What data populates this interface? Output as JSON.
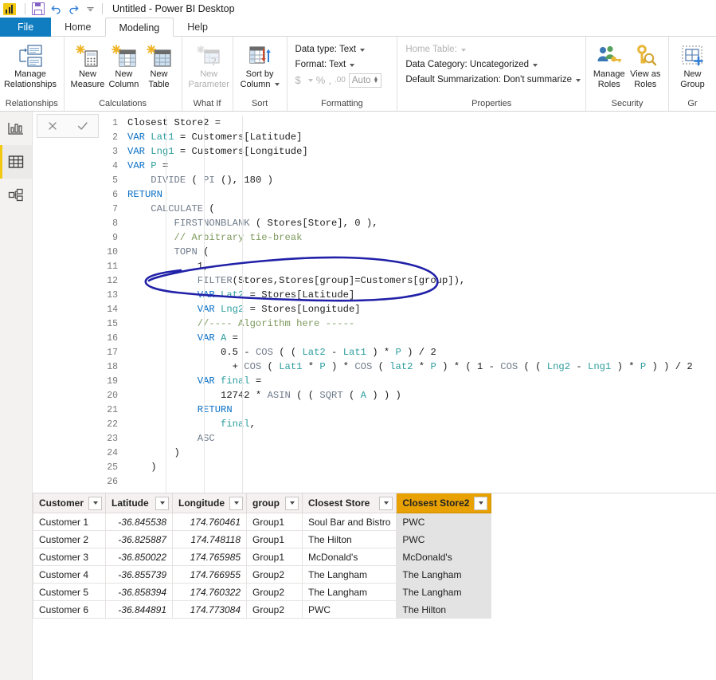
{
  "titlebar": {
    "title": "Untitled - Power BI Desktop",
    "icons": [
      "power-bi-logo",
      "save-icon",
      "undo-icon",
      "redo-icon",
      "customize-quick-access-chevron"
    ]
  },
  "tabs": [
    {
      "label": "File",
      "state": "file"
    },
    {
      "label": "Home",
      "state": "normal"
    },
    {
      "label": "Modeling",
      "state": "active"
    },
    {
      "label": "Help",
      "state": "normal"
    }
  ],
  "ribbon": {
    "groups": [
      {
        "label": "Relationships",
        "buttons": [
          {
            "label_line1": "Manage",
            "label_line2": "Relationships",
            "icon": "manage-relationships-icon",
            "disabled": false
          }
        ]
      },
      {
        "label": "Calculations",
        "buttons": [
          {
            "label_line1": "New",
            "label_line2": "Measure",
            "icon": "new-measure-icon",
            "disabled": false
          },
          {
            "label_line1": "New",
            "label_line2": "Column",
            "icon": "new-column-icon",
            "disabled": false
          },
          {
            "label_line1": "New",
            "label_line2": "Table",
            "icon": "new-table-icon",
            "disabled": false
          }
        ]
      },
      {
        "label": "What If",
        "buttons": [
          {
            "label_line1": "New",
            "label_line2": "Parameter",
            "icon": "new-parameter-icon",
            "disabled": true
          }
        ]
      },
      {
        "label": "Sort",
        "buttons": [
          {
            "label_line1": "Sort by",
            "label_line2": "Column",
            "icon": "sort-by-column-icon",
            "disabled": false
          }
        ]
      },
      {
        "label": "Formatting",
        "rows": {
          "data_type": "Data type: Text",
          "format": "Format: Text",
          "currency": "$",
          "percent": "%",
          "comma": ",",
          "decimal": ".00",
          "auto": "Auto"
        }
      },
      {
        "label": "Properties",
        "rows": {
          "home_table": "Home Table:",
          "data_category": "Data Category: Uncategorized",
          "default_summarization": "Default Summarization: Don't summarize"
        }
      },
      {
        "label": "Security",
        "buttons": [
          {
            "label_line1": "Manage",
            "label_line2": "Roles",
            "icon": "manage-roles-icon",
            "disabled": false
          },
          {
            "label_line1": "View as",
            "label_line2": "Roles",
            "icon": "view-as-roles-icon",
            "disabled": false
          }
        ]
      },
      {
        "label": "Gr",
        "buttons": [
          {
            "label_line1": "New",
            "label_line2": "Group",
            "icon": "new-group-icon",
            "disabled": false
          }
        ]
      }
    ]
  },
  "rail": {
    "items": [
      {
        "name": "report-view",
        "icon": "bar-chart-icon",
        "selected": false
      },
      {
        "name": "data-view",
        "icon": "table-grid-icon",
        "selected": true
      },
      {
        "name": "model-view",
        "icon": "relationship-model-icon",
        "selected": false
      }
    ]
  },
  "formula_bar": {
    "cancel_icon": "close-x-icon",
    "accept_icon": "checkmark-icon",
    "lines": [
      {
        "n": "1",
        "segs": [
          {
            "t": "Closest Store2 =",
            "c": "pl"
          }
        ]
      },
      {
        "n": "2",
        "segs": [
          {
            "t": "VAR ",
            "c": "k"
          },
          {
            "t": "Lat1",
            "c": "var"
          },
          {
            "t": " = Customers[Latitude]",
            "c": "pl"
          }
        ]
      },
      {
        "n": "3",
        "segs": [
          {
            "t": "VAR ",
            "c": "k"
          },
          {
            "t": "Lng1",
            "c": "var"
          },
          {
            "t": " = Customers[Longitude]",
            "c": "pl"
          }
        ]
      },
      {
        "n": "4",
        "segs": [
          {
            "t": "VAR ",
            "c": "k"
          },
          {
            "t": "P",
            "c": "var"
          },
          {
            "t": " =",
            "c": "pl"
          }
        ]
      },
      {
        "n": "5",
        "segs": [
          {
            "t": "    ",
            "c": "pl"
          },
          {
            "t": "DIVIDE",
            "c": "fn"
          },
          {
            "t": " ( ",
            "c": "pl"
          },
          {
            "t": "PI",
            "c": "fn"
          },
          {
            "t": " (), ",
            "c": "pl"
          },
          {
            "t": "180",
            "c": "num"
          },
          {
            "t": " )",
            "c": "pl"
          }
        ]
      },
      {
        "n": "6",
        "segs": [
          {
            "t": "RETURN",
            "c": "k"
          }
        ]
      },
      {
        "n": "7",
        "segs": [
          {
            "t": "    ",
            "c": "pl"
          },
          {
            "t": "CALCULATE",
            "c": "fn"
          },
          {
            "t": " (",
            "c": "pl"
          }
        ]
      },
      {
        "n": "8",
        "segs": [
          {
            "t": "        ",
            "c": "pl"
          },
          {
            "t": "FIRSTNONBLANK",
            "c": "fn"
          },
          {
            "t": " ( Stores[Store], ",
            "c": "pl"
          },
          {
            "t": "0",
            "c": "num"
          },
          {
            "t": " ),",
            "c": "pl"
          }
        ]
      },
      {
        "n": "9",
        "segs": [
          {
            "t": "        ",
            "c": "pl"
          },
          {
            "t": "// Arbitrary tie-break",
            "c": "cm"
          }
        ]
      },
      {
        "n": "10",
        "segs": [
          {
            "t": "        ",
            "c": "pl"
          },
          {
            "t": "TOPN",
            "c": "fn"
          },
          {
            "t": " (",
            "c": "pl"
          }
        ]
      },
      {
        "n": "11",
        "segs": [
          {
            "t": "            ",
            "c": "pl"
          },
          {
            "t": "1",
            "c": "num"
          },
          {
            "t": ",",
            "c": "pl"
          }
        ]
      },
      {
        "n": "12",
        "segs": [
          {
            "t": "            ",
            "c": "pl"
          },
          {
            "t": "FILTER",
            "c": "fn"
          },
          {
            "t": "(Stores,Stores[group]=Customers[group]),",
            "c": "pl"
          }
        ]
      },
      {
        "n": "13",
        "segs": [
          {
            "t": "            ",
            "c": "pl"
          },
          {
            "t": "VAR ",
            "c": "k"
          },
          {
            "t": "Lat2",
            "c": "var"
          },
          {
            "t": " = Stores[Latitude]",
            "c": "pl"
          }
        ]
      },
      {
        "n": "14",
        "segs": [
          {
            "t": "            ",
            "c": "pl"
          },
          {
            "t": "VAR ",
            "c": "k"
          },
          {
            "t": "Lng2",
            "c": "var"
          },
          {
            "t": " = Stores[Longitude]",
            "c": "pl"
          }
        ]
      },
      {
        "n": "15",
        "segs": [
          {
            "t": "            ",
            "c": "pl"
          },
          {
            "t": "//---- Algorithm here -----",
            "c": "cm"
          }
        ]
      },
      {
        "n": "16",
        "segs": [
          {
            "t": "            ",
            "c": "pl"
          },
          {
            "t": "VAR ",
            "c": "k"
          },
          {
            "t": "A",
            "c": "var"
          },
          {
            "t": " =",
            "c": "pl"
          }
        ]
      },
      {
        "n": "17",
        "segs": [
          {
            "t": "                ",
            "c": "pl"
          },
          {
            "t": "0.5",
            "c": "num"
          },
          {
            "t": " - ",
            "c": "pl"
          },
          {
            "t": "COS",
            "c": "fn"
          },
          {
            "t": " ( ( ",
            "c": "pl"
          },
          {
            "t": "Lat2",
            "c": "var"
          },
          {
            "t": " - ",
            "c": "pl"
          },
          {
            "t": "Lat1",
            "c": "var"
          },
          {
            "t": " ) * ",
            "c": "pl"
          },
          {
            "t": "P",
            "c": "var"
          },
          {
            "t": " ) / ",
            "c": "pl"
          },
          {
            "t": "2",
            "c": "num"
          }
        ]
      },
      {
        "n": "18",
        "segs": [
          {
            "t": "                  + ",
            "c": "pl"
          },
          {
            "t": "COS",
            "c": "fn"
          },
          {
            "t": " ( ",
            "c": "pl"
          },
          {
            "t": "Lat1",
            "c": "var"
          },
          {
            "t": " * ",
            "c": "pl"
          },
          {
            "t": "P",
            "c": "var"
          },
          {
            "t": " ) * ",
            "c": "pl"
          },
          {
            "t": "COS",
            "c": "fn"
          },
          {
            "t": " ( ",
            "c": "pl"
          },
          {
            "t": "lat2",
            "c": "var"
          },
          {
            "t": " * ",
            "c": "pl"
          },
          {
            "t": "P",
            "c": "var"
          },
          {
            "t": " ) * ( ",
            "c": "pl"
          },
          {
            "t": "1",
            "c": "num"
          },
          {
            "t": " - ",
            "c": "pl"
          },
          {
            "t": "COS",
            "c": "fn"
          },
          {
            "t": " ( ( ",
            "c": "pl"
          },
          {
            "t": "Lng2",
            "c": "var"
          },
          {
            "t": " - ",
            "c": "pl"
          },
          {
            "t": "Lng1",
            "c": "var"
          },
          {
            "t": " ) * ",
            "c": "pl"
          },
          {
            "t": "P",
            "c": "var"
          },
          {
            "t": " ) ) / ",
            "c": "pl"
          },
          {
            "t": "2",
            "c": "num"
          }
        ]
      },
      {
        "n": "19",
        "segs": [
          {
            "t": "            ",
            "c": "pl"
          },
          {
            "t": "VAR ",
            "c": "k"
          },
          {
            "t": "final",
            "c": "var"
          },
          {
            "t": " =",
            "c": "pl"
          }
        ]
      },
      {
        "n": "20",
        "segs": [
          {
            "t": "                ",
            "c": "pl"
          },
          {
            "t": "12742",
            "c": "num"
          },
          {
            "t": " * ",
            "c": "pl"
          },
          {
            "t": "ASIN",
            "c": "fn"
          },
          {
            "t": " ( ( ",
            "c": "pl"
          },
          {
            "t": "SQRT",
            "c": "fn"
          },
          {
            "t": " ( ",
            "c": "pl"
          },
          {
            "t": "A",
            "c": "var"
          },
          {
            "t": " ) ) )",
            "c": "pl"
          }
        ]
      },
      {
        "n": "21",
        "segs": [
          {
            "t": "            ",
            "c": "pl"
          },
          {
            "t": "RETURN",
            "c": "k"
          }
        ]
      },
      {
        "n": "22",
        "segs": [
          {
            "t": "                ",
            "c": "pl"
          },
          {
            "t": "final",
            "c": "var"
          },
          {
            "t": ",",
            "c": "pl"
          }
        ]
      },
      {
        "n": "23",
        "segs": [
          {
            "t": "            ",
            "c": "pl"
          },
          {
            "t": "ASC",
            "c": "fn"
          }
        ]
      },
      {
        "n": "24",
        "segs": [
          {
            "t": "        )",
            "c": "pl"
          }
        ]
      },
      {
        "n": "25",
        "segs": [
          {
            "t": "    )",
            "c": "pl"
          }
        ]
      },
      {
        "n": "26",
        "segs": []
      }
    ],
    "annotation": {
      "shape": "hand-drawn-ellipse",
      "color": "#2020a8",
      "targets_line": "12"
    }
  },
  "grid": {
    "columns": [
      {
        "label": "Customer",
        "align": "left",
        "highlight": false
      },
      {
        "label": "Latitude",
        "align": "right",
        "highlight": false
      },
      {
        "label": "Longitude",
        "align": "right",
        "highlight": false
      },
      {
        "label": "group",
        "align": "left",
        "highlight": false
      },
      {
        "label": "Closest Store",
        "align": "left",
        "highlight": false
      },
      {
        "label": "Closest Store2",
        "align": "left",
        "highlight": true
      }
    ],
    "rows": [
      [
        "Customer 1",
        "-36.845538",
        "174.760461",
        "Group1",
        "Soul Bar and Bistro",
        "PWC"
      ],
      [
        "Customer 2",
        "-36.825887",
        "174.748118",
        "Group1",
        "The Hilton",
        "PWC"
      ],
      [
        "Customer 3",
        "-36.850022",
        "174.765985",
        "Group1",
        "McDonald's",
        "McDonald's"
      ],
      [
        "Customer 4",
        "-36.855739",
        "174.766955",
        "Group2",
        "The Langham",
        "The Langham"
      ],
      [
        "Customer 5",
        "-36.858394",
        "174.760322",
        "Group2",
        "The Langham",
        "The Langham"
      ],
      [
        "Customer 6",
        "-36.844891",
        "174.773084",
        "Group2",
        "PWC",
        "The Hilton"
      ]
    ]
  },
  "colors": {
    "accent_blue": "#117dc1",
    "highlight_gold": "#e8a100",
    "rail_selected": "#f2c811",
    "annotation": "#2020a8",
    "keyword": "#0b70c6",
    "variable": "#2e9d9d",
    "comment": "#7e9a5e",
    "function": "#6f7b8a"
  }
}
